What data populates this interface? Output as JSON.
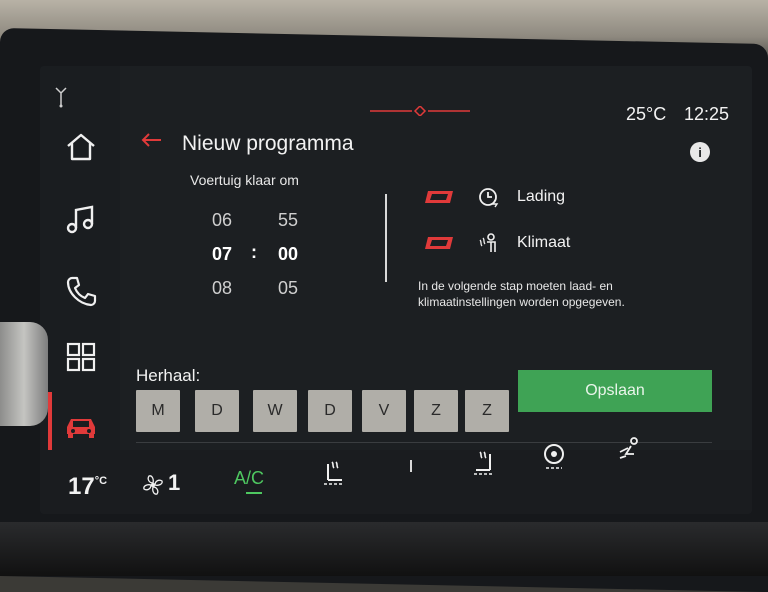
{
  "status": {
    "outside_temp": "25°C",
    "time": "12:25",
    "info_label": "i"
  },
  "header": {
    "title": "Nieuw programma",
    "subtitle": "Voertuig klaar om"
  },
  "time_picker": {
    "hours": [
      "06",
      "07",
      "08"
    ],
    "minutes": [
      "55",
      "00",
      "05"
    ],
    "separator": ":"
  },
  "options": [
    {
      "label": "Lading",
      "icon": "charging-clock-icon"
    },
    {
      "label": "Klimaat",
      "icon": "climate-person-icon"
    }
  ],
  "hint": "In de volgende stap moeten laad- en klimaatinstellingen worden opgegeven.",
  "repeat": {
    "label": "Herhaal:",
    "days": [
      "M",
      "D",
      "W",
      "D",
      "V",
      "Z",
      "Z"
    ]
  },
  "save_label": "Opslaan",
  "climate": {
    "temperature": "17",
    "temperature_unit": "°C",
    "fan_level": "1",
    "ac_label": "A/C"
  },
  "colors": {
    "accent_red": "#e03a3a",
    "save_green": "#3fa355",
    "ac_green": "#4ec760"
  }
}
